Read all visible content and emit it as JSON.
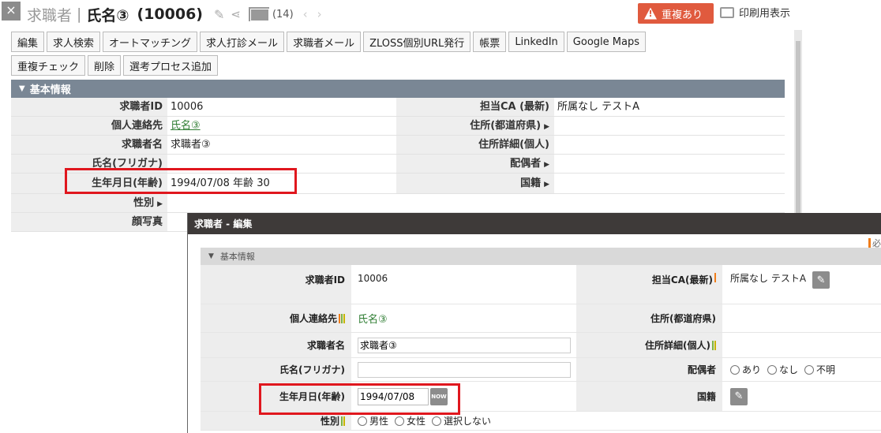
{
  "header": {
    "close_glyph": "×",
    "kind": "求職者",
    "separator": "|",
    "name": "氏名③",
    "id": "(10006)",
    "mail_count": "(14)",
    "duplicate_badge": "重複あり",
    "print_label": "印刷用表示"
  },
  "toolbar": {
    "row1": [
      "編集",
      "求人検索",
      "オートマッチング",
      "求人打診メール",
      "求職者メール",
      "ZLOSS個別URL発行",
      "帳票",
      "LinkedIn",
      "Google Maps"
    ],
    "row2": [
      "重複チェック",
      "削除",
      "選考プロセス追加"
    ]
  },
  "basic_info": {
    "section_title": "基本情報",
    "rows": [
      {
        "label": "求職者ID",
        "value": "10006",
        "label2": "担当CA (最新)",
        "value2": "所属なし テストA"
      },
      {
        "label": "個人連絡先",
        "value": "氏名③",
        "label2": "住所(都道府県)",
        "value2": ""
      },
      {
        "label": "求職者名",
        "value": "求職者③",
        "label2": "住所詳細(個人)",
        "value2": ""
      },
      {
        "label": "氏名(フリガナ)",
        "value": "",
        "label2": "配偶者",
        "value2": ""
      },
      {
        "label": "生年月日(年齢)",
        "value": "1994/07/08 年齢 30",
        "label2": "国籍",
        "value2": ""
      },
      {
        "label": "性別",
        "value": "",
        "label2": "",
        "value2": ""
      },
      {
        "label": "顔写真",
        "value": "",
        "label2": "",
        "value2": ""
      }
    ]
  },
  "edit_dialog": {
    "title": "求職者 - 編集",
    "required_mark": "必",
    "section_title": "基本情報",
    "id_label": "求職者ID",
    "id_value": "10006",
    "ca_label": "担当CA(最新)",
    "ca_value": "所属なし テストA",
    "contact_label": "個人連絡先",
    "contact_value": "氏名③",
    "pref_label": "住所(都道府県)",
    "name_label": "求職者名",
    "name_value": "求職者③",
    "addr_label": "住所詳細(個人)",
    "kana_label": "氏名(フリガナ)",
    "kana_value": "",
    "spouse_label": "配偶者",
    "spouse_options": [
      "あり",
      "なし",
      "不明"
    ],
    "birth_label": "生年月日(年齢)",
    "birth_value": "1994/07/08",
    "now_label": "NOW",
    "nationality_label": "国籍",
    "gender_label": "性別",
    "gender_options": [
      "男性",
      "女性",
      "選択しない"
    ]
  },
  "colors": {
    "highlight_box": "#e0171e",
    "duplicate_badge_bg": "#e05a3e",
    "section_header_bg": "#7a8795",
    "dialog_title_bg": "#3e3a39",
    "link_green": "#2e7d32"
  }
}
